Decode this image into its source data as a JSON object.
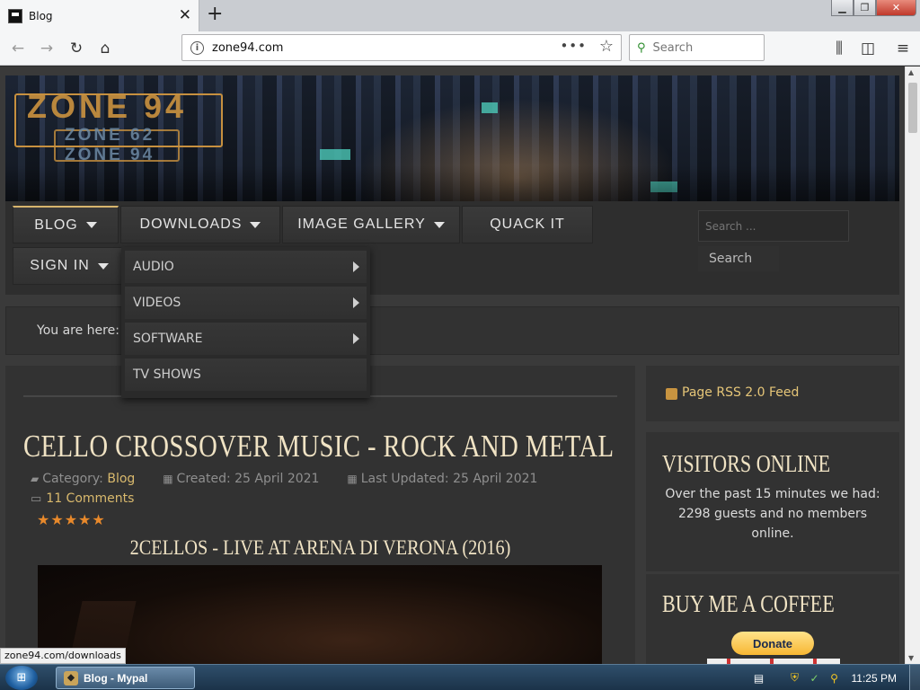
{
  "browser": {
    "tab_title": "Blog",
    "url": "zone94.com",
    "search_placeholder": "Search",
    "new_tab_symbol": "+",
    "close_symbol": "✕",
    "more_symbol": "•••",
    "status_url": "zone94.com/downloads"
  },
  "site": {
    "logo_main": "ZONE 94",
    "logo_sub1": "ZONE 62",
    "logo_sub2": "ZONE 94",
    "menu": [
      {
        "label": "BLOG"
      },
      {
        "label": "DOWNLOADS"
      },
      {
        "label": "IMAGE GALLERY"
      },
      {
        "label": "QUACK IT"
      },
      {
        "label": "SIGN IN"
      }
    ],
    "dropdown": [
      {
        "label": "AUDIO"
      },
      {
        "label": "VIDEOS"
      },
      {
        "label": "SOFTWARE"
      },
      {
        "label": "TV SHOWS"
      }
    ],
    "search_placeholder": "Search ...",
    "search_button": "Search",
    "breadcrumb": "You are here:"
  },
  "article": {
    "title": "CELLO CROSSOVER MUSIC - ROCK AND METAL",
    "category_label": "Category:",
    "category_value": "Blog",
    "created": "Created: 25 April 2021",
    "updated": "Last Updated: 25 April 2021",
    "comments": "11 Comments",
    "rating": "★★★★★",
    "video_title": "2CELLOS - LIVE AT ARENA DI VERONA (2016)"
  },
  "sidebar": {
    "rss": "Page RSS 2.0 Feed",
    "visitors_title": "VISITORS ONLINE",
    "visitors_text": "Over the past 15 minutes we had: 2298 guests and no members online.",
    "coffee_title": "BUY ME A COFFEE",
    "donate_label": "Donate"
  },
  "taskbar": {
    "window_label": "Blog - Mypal",
    "clock": "11:25 PM"
  },
  "colors": {
    "accent": "#d9b96d",
    "star": "#e8892b",
    "title": "#f0e3c4"
  }
}
